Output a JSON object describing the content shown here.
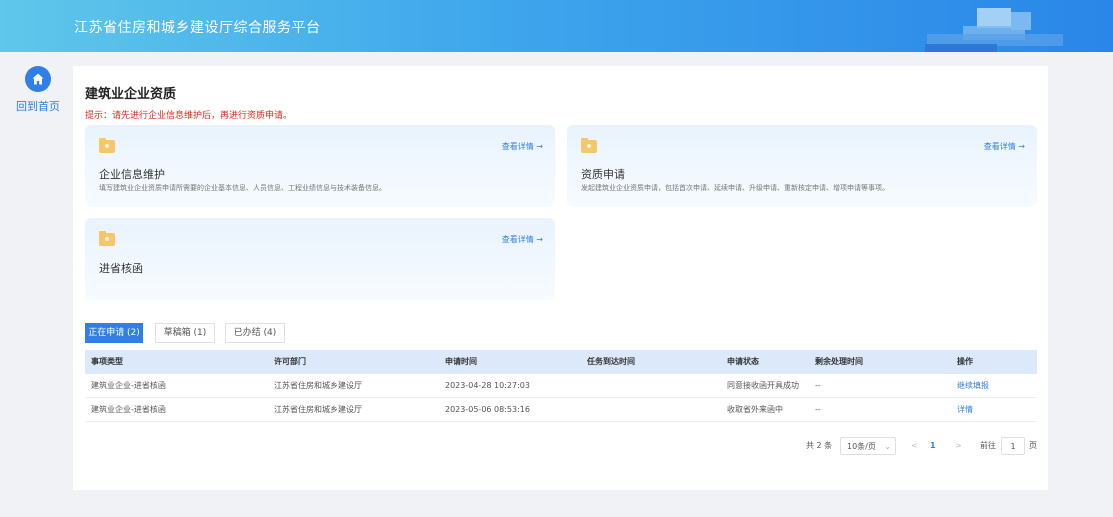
{
  "header": {
    "title": "江苏省住房和城乡建设厅综合服务平台"
  },
  "sidebar": {
    "home_label": "回到首页",
    "home_icon": "home-icon"
  },
  "page": {
    "title": "建筑业企业资质",
    "tip": "提示：请先进行企业信息维护后，再进行资质申请。"
  },
  "cards": [
    {
      "icon": "folder-icon",
      "link": "查看详情 →",
      "title": "企业信息维护",
      "desc": "填写建筑业企业资质申请所需要的企业基本信息、人员信息、工程业绩信息与技术装备信息。"
    },
    {
      "icon": "folder-icon",
      "link": "查看详情 →",
      "title": "资质申请",
      "desc": "发起建筑业企业资质申请，包括首次申请、延续申请、升级申请、重新核定申请、增项申请等事项。"
    },
    {
      "icon": "folder-icon",
      "link": "查看详情 →",
      "title": "进省核函",
      "desc": ""
    }
  ],
  "tabs": [
    {
      "label": "正在申请 (2)",
      "active": true
    },
    {
      "label": "草稿箱 (1)",
      "active": false
    },
    {
      "label": "已办结 (4)",
      "active": false
    }
  ],
  "table": {
    "headers": [
      "事项类型",
      "许可部门",
      "申请时间",
      "任务到达时间",
      "申请状态",
      "剩余处理时间",
      "操作"
    ],
    "rows": [
      [
        "建筑业企业-进省核函",
        "江苏省住房和城乡建设厅",
        "2023-04-28 10:27:03",
        "",
        "同意接收函开具成功",
        "--",
        "继续填报"
      ],
      [
        "建筑业企业-进省核函",
        "江苏省住房和城乡建设厅",
        "2023-05-06 08:53:16",
        "",
        "收取省外来函中",
        "--",
        "详情"
      ]
    ]
  },
  "pagination": {
    "total": "共 2 条",
    "page_size": "10条/页",
    "prev": "<",
    "current": "1",
    "next": ">",
    "goto_label": "前往",
    "goto_value": "1",
    "page_suffix": "页"
  },
  "colors": {
    "accent": "#2f7fe6",
    "warning": "#e0281a"
  }
}
